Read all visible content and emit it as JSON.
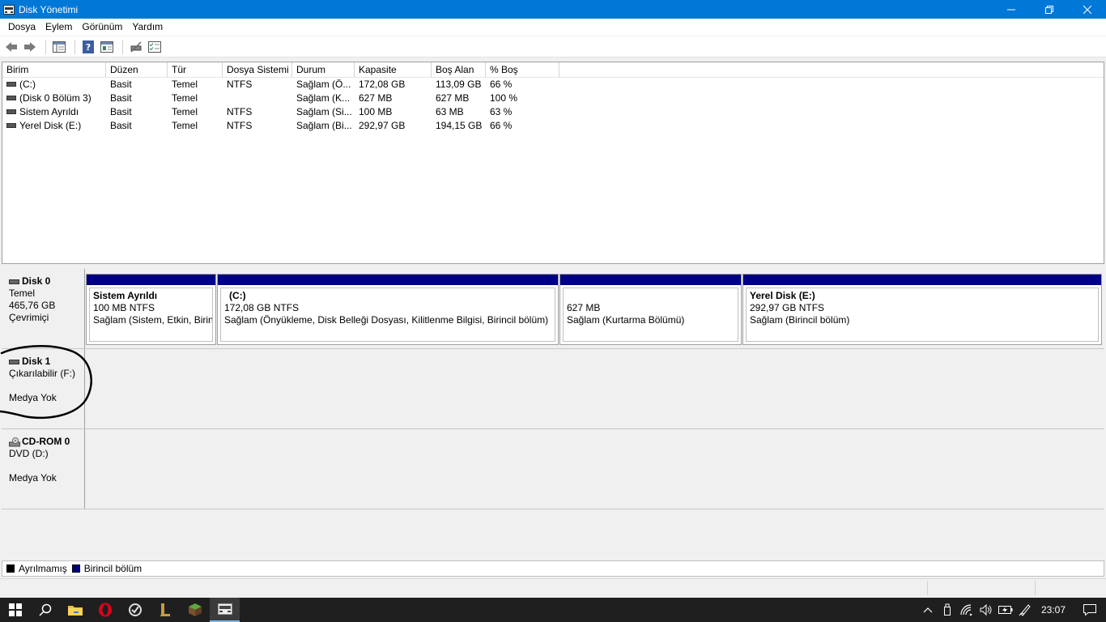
{
  "window": {
    "title": "Disk Yönetimi"
  },
  "menu": [
    "Dosya",
    "Eylem",
    "Görünüm",
    "Yardım"
  ],
  "volume_table": {
    "columns": [
      "Birim",
      "Düzen",
      "Tür",
      "Dosya Sistemi",
      "Durum",
      "Kapasite",
      "Boş Alan",
      "% Boş"
    ],
    "rows": [
      [
        "(C:)",
        "Basit",
        "Temel",
        "NTFS",
        "Sağlam (Ö...",
        "172,08 GB",
        "113,09 GB",
        "66 %"
      ],
      [
        "(Disk 0 Bölüm 3)",
        "Basit",
        "Temel",
        "",
        "Sağlam (K...",
        "627 MB",
        "627 MB",
        "100 %"
      ],
      [
        "Sistem Ayrıldı",
        "Basit",
        "Temel",
        "NTFS",
        "Sağlam (Si...",
        "100 MB",
        "63 MB",
        "63 %"
      ],
      [
        "Yerel Disk (E:)",
        "Basit",
        "Temel",
        "NTFS",
        "Sağlam (Bi...",
        "292,97 GB",
        "194,15 GB",
        "66 %"
      ]
    ]
  },
  "disks": [
    {
      "name": "Disk 0",
      "lines": [
        "Temel",
        "465,76 GB",
        "Çevrimiçi"
      ],
      "partitions": [
        {
          "name": "Sistem Ayrıldı",
          "size": "100 MB NTFS",
          "status": "Sağlam (Sistem, Etkin, Birincil bölüm)"
        },
        {
          "name": "(C:)",
          "size": "172,08 GB NTFS",
          "status": "Sağlam (Önyükleme, Disk Belleği Dosyası, Kilitlenme Bilgisi, Birincil bölüm)"
        },
        {
          "name": "",
          "size": "627 MB",
          "status": "Sağlam (Kurtarma Bölümü)"
        },
        {
          "name": "Yerel Disk  (E:)",
          "size": "292,97 GB NTFS",
          "status": "Sağlam (Birincil bölüm)"
        }
      ]
    },
    {
      "name": "Disk 1",
      "lines": [
        "Çıkarılabilir (F:)",
        "",
        "Medya Yok"
      ]
    },
    {
      "name": "CD-ROM 0",
      "lines": [
        "DVD (D:)",
        "",
        "Medya Yok"
      ]
    }
  ],
  "legend": [
    {
      "label": "Ayrılmamış",
      "color": "#000000"
    },
    {
      "label": "Birincil bölüm",
      "color": "#000080"
    }
  ],
  "taskbar": {
    "apps": [
      "start-icon",
      "search-icon",
      "file-explorer-icon",
      "opera-icon",
      "app-icon",
      "lol-icon",
      "minecraft-icon",
      "disk-management-icon"
    ],
    "clock": "23:07"
  },
  "colors": {
    "titlebar": "#0078d7",
    "partition_bar": "#000080",
    "taskbar": "#1f1f1f"
  }
}
